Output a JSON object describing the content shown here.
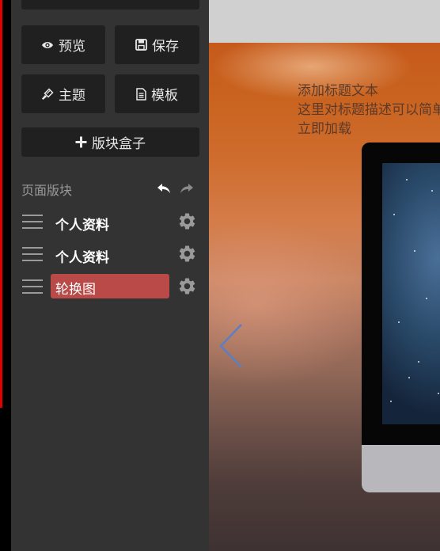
{
  "toolbar": {
    "preview_label": "预览",
    "save_label": "保存",
    "theme_label": "主题",
    "template_label": "模板",
    "block_box_label": "版块盒子"
  },
  "blocks_panel": {
    "title": "页面版块",
    "items": [
      {
        "label": "个人资料",
        "active": false
      },
      {
        "label": "个人资料",
        "active": false
      },
      {
        "label": "轮换图",
        "active": true
      }
    ]
  },
  "hero": {
    "title": "添加标题文本",
    "description": "这里对标题描述可以简单",
    "link": "立即加载"
  },
  "colors": {
    "sidebar_bg": "#333333",
    "button_bg": "#202020",
    "active_item": "#b94a48",
    "accent_red": "#e00000",
    "hero_orange": "#c9631f",
    "arrow_blue": "#5b7fc4"
  },
  "icons": {
    "preview": "eye-icon",
    "save": "floppy-disk-icon",
    "theme": "paintbrush-icon",
    "template": "document-icon",
    "block_box": "plus-icon",
    "undo": "undo-icon",
    "redo": "redo-icon",
    "drag": "drag-handle-icon",
    "settings": "gear-icon",
    "prev": "chevron-left-icon"
  }
}
